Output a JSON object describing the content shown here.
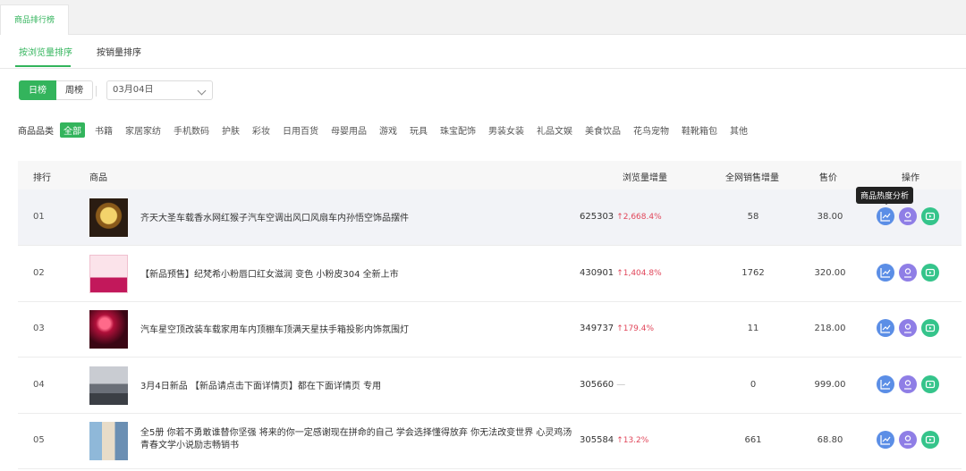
{
  "top_tab": "商品排行榜",
  "sub_tabs": [
    {
      "label": "按浏览量排序",
      "active": true
    },
    {
      "label": "按销量排序",
      "active": false
    }
  ],
  "period": {
    "day": "日榜",
    "week": "周榜"
  },
  "date": "03月04日",
  "category": {
    "label": "商品品类",
    "items": [
      "全部",
      "书籍",
      "家居家纺",
      "手机数码",
      "护肤",
      "彩妆",
      "日用百货",
      "母婴用品",
      "游戏",
      "玩具",
      "珠宝配饰",
      "男装女装",
      "礼品文娱",
      "美食饮品",
      "花鸟宠物",
      "鞋靴箱包",
      "其他"
    ]
  },
  "table": {
    "headers": {
      "rank": "排行",
      "product": "商品",
      "views": "浏览量增量",
      "sales": "全网销售增量",
      "price": "售价",
      "ops": "操作"
    },
    "rows": [
      {
        "rank": "01",
        "name": "齐天大圣车载香水网红猴子汽车空调出风口风扇车内孙悟空饰品摆件",
        "views": "625303",
        "growth": "↑2,668.4%",
        "sales": "58",
        "price": "38.00"
      },
      {
        "rank": "02",
        "name": "【新品预售】纪梵希小粉唇口红女滋润 变色 小粉皮304 全新上市",
        "views": "430901",
        "growth": "↑1,404.8%",
        "sales": "1762",
        "price": "320.00"
      },
      {
        "rank": "03",
        "name": "汽车星空顶改装车载家用车内顶棚车顶满天星扶手箱投影内饰氛围灯",
        "views": "349737",
        "growth": "↑179.4%",
        "sales": "11",
        "price": "218.00"
      },
      {
        "rank": "04",
        "name": "3月4日新品 【新品请点击下面详情页】都在下面详情页 专用",
        "views": "305660",
        "growth": "—",
        "sales": "0",
        "price": "999.00"
      },
      {
        "rank": "05",
        "name": "全5册 你若不勇敢谁替你坚强 将来的你一定感谢现在拼命的自己 学会选择懂得放弃 你无法改变世界 心灵鸡汤青春文学小说励志畅销书",
        "views": "305584",
        "growth": "↑13.2%",
        "sales": "661",
        "price": "68.80"
      }
    ]
  },
  "tooltip": "商品热度分析",
  "op_icons": [
    "trend-chart-icon",
    "user-badge-icon",
    "video-play-icon"
  ],
  "colors": {
    "accent": "#33b45c",
    "growth": "#e1475b",
    "op_blue": "#5b8ee6",
    "op_purple": "#8f7ee6",
    "op_green": "#35c48b"
  }
}
